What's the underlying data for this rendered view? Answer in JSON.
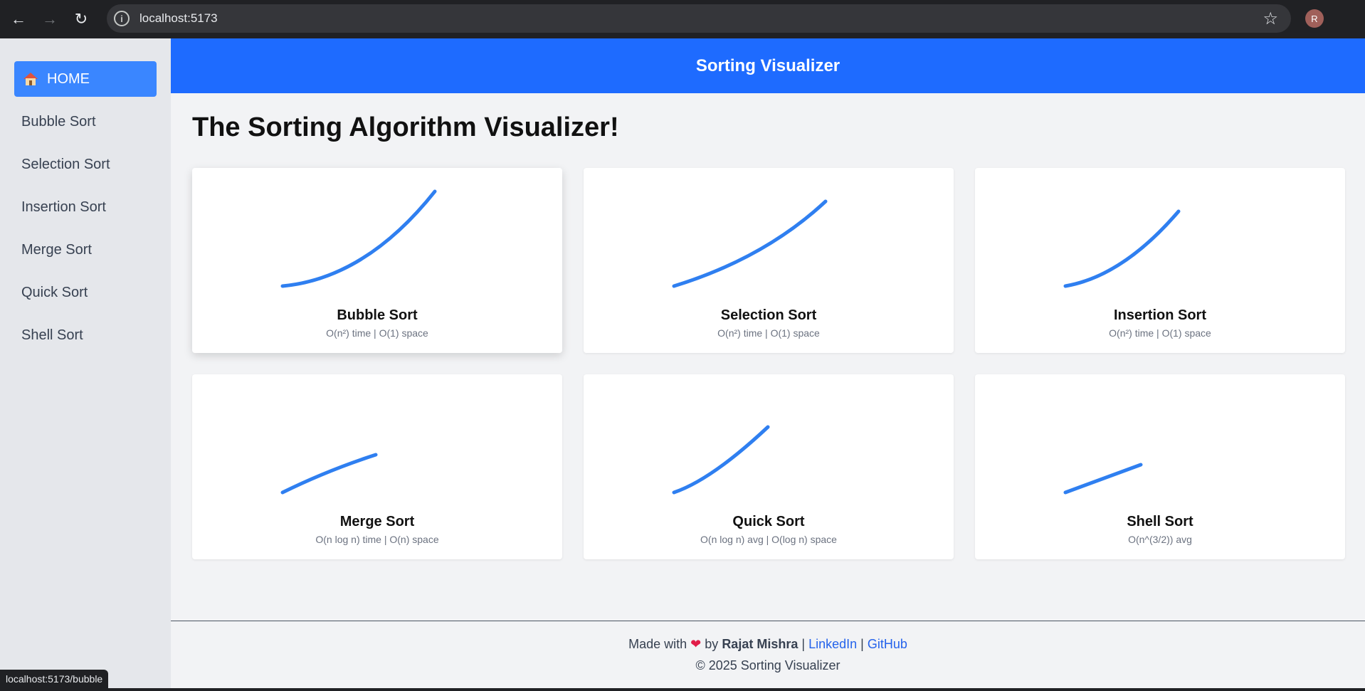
{
  "browser": {
    "url": "localhost:5173",
    "profile_initial": "R",
    "status_url": "localhost:5173/bubble"
  },
  "sidebar": {
    "home_label": "HOME",
    "items": [
      {
        "label": "Bubble Sort"
      },
      {
        "label": "Selection Sort"
      },
      {
        "label": "Insertion Sort"
      },
      {
        "label": "Merge Sort"
      },
      {
        "label": "Quick Sort"
      },
      {
        "label": "Shell Sort"
      }
    ]
  },
  "header": {
    "title": "Sorting Visualizer"
  },
  "main": {
    "title": "The Sorting Algorithm Visualizer!",
    "cards": [
      {
        "title": "Bubble Sort",
        "complexity": "O(n²) time | O(1) space"
      },
      {
        "title": "Selection Sort",
        "complexity": "O(n²) time | O(1) space"
      },
      {
        "title": "Insertion Sort",
        "complexity": "O(n²) time | O(1) space"
      },
      {
        "title": "Merge Sort",
        "complexity": "O(n log n) time | O(n) space"
      },
      {
        "title": "Quick Sort",
        "complexity": "O(n log n) avg | O(log n) space"
      },
      {
        "title": "Shell Sort",
        "complexity": "O(n^(3/2)) avg"
      }
    ]
  },
  "footer": {
    "made_with": "Made with",
    "by": "by",
    "author": "Rajat Mishra",
    "sep": "|",
    "linkedin": "LinkedIn",
    "github": "GitHub",
    "copyright": "© 2025 Sorting Visualizer"
  },
  "colors": {
    "accent": "#1e6bff",
    "home_button": "#3a86ff",
    "curve": "#2f7ff0"
  }
}
